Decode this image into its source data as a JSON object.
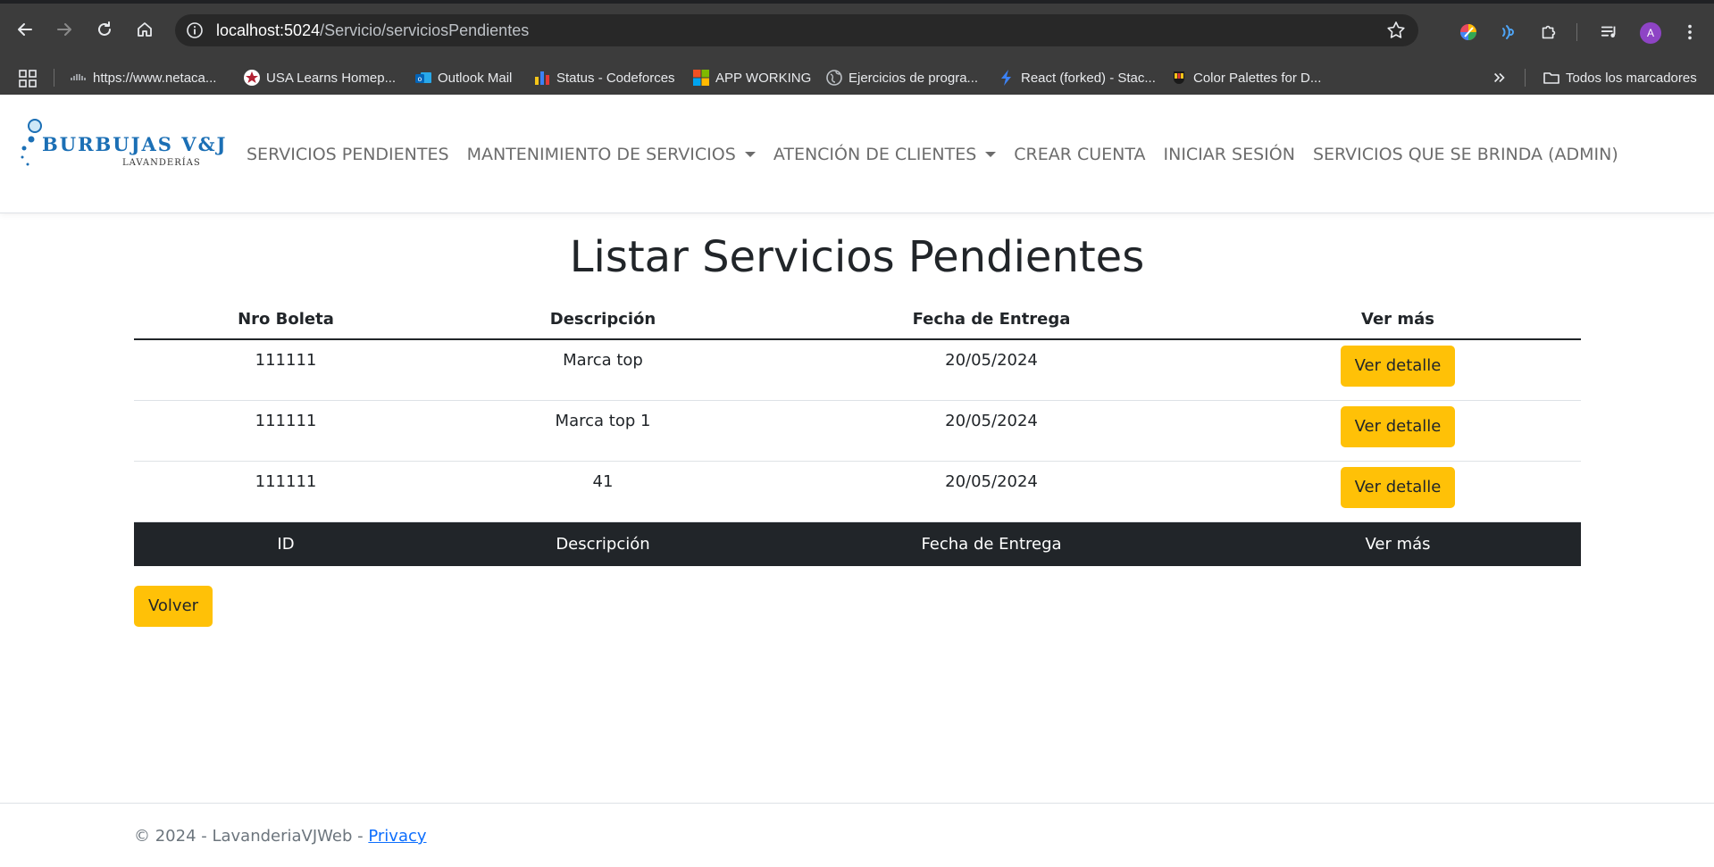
{
  "browser": {
    "url_host": "localhost:5024",
    "url_path": "/Servicio/serviciosPendientes",
    "avatar_letter": "A",
    "bookmarks": [
      {
        "label": "https://www.netaca...",
        "icon": "cisco-icon"
      },
      {
        "label": "USA Learns Homep...",
        "icon": "star-badge-icon"
      },
      {
        "label": "Outlook Mail",
        "icon": "outlook-icon"
      },
      {
        "label": "Status - Codeforces",
        "icon": "bar-chart-icon"
      },
      {
        "label": "APP WORKING",
        "icon": "windows-icon"
      },
      {
        "label": "Ejercicios de progra...",
        "icon": "globe-icon"
      },
      {
        "label": "React (forked) - Stac...",
        "icon": "bolt-icon"
      },
      {
        "label": "Color Palettes for D...",
        "icon": "palette-icon"
      }
    ],
    "all_bookmarks_label": "Todos los marcadores"
  },
  "site": {
    "logo_name": "BURBUJAS V&J",
    "logo_sub": "LAVANDERÍAS",
    "nav": {
      "servicios_pendientes": "SERVICIOS PENDIENTES",
      "mantenimiento": "MANTENIMIENTO DE SERVICIOS",
      "atencion": "ATENCIÓN DE CLIENTES",
      "crear_cuenta": "CREAR CUENTA",
      "iniciar_sesion": "INICIAR SESIÓN",
      "servicios_admin": "SERVICIOS QUE SE BRINDA (ADMIN)"
    }
  },
  "main": {
    "title": "Listar Servicios Pendientes",
    "table": {
      "headers": [
        "Nro Boleta",
        "Descripción",
        "Fecha de Entrega",
        "Ver más"
      ],
      "rows": [
        {
          "boleta": "111111",
          "descripcion": "Marca top",
          "fecha": "20/05/2024",
          "action": "Ver detalle"
        },
        {
          "boleta": "111111",
          "descripcion": "Marca top 1",
          "fecha": "20/05/2024",
          "action": "Ver detalle"
        },
        {
          "boleta": "111111",
          "descripcion": "41",
          "fecha": "20/05/2024",
          "action": "Ver detalle"
        }
      ],
      "footer": [
        "ID",
        "Descripción",
        "Fecha de Entrega",
        "Ver más"
      ]
    },
    "back_label": "Volver"
  },
  "footer": {
    "copyright": "© 2024 - LavanderiaVJWeb - ",
    "privacy": "Privacy"
  },
  "colors": {
    "accent_yellow": "#ffc107",
    "table_footer_dark": "#212529",
    "link_blue": "#0d6efd",
    "logo_blue": "#1b6fb5"
  }
}
